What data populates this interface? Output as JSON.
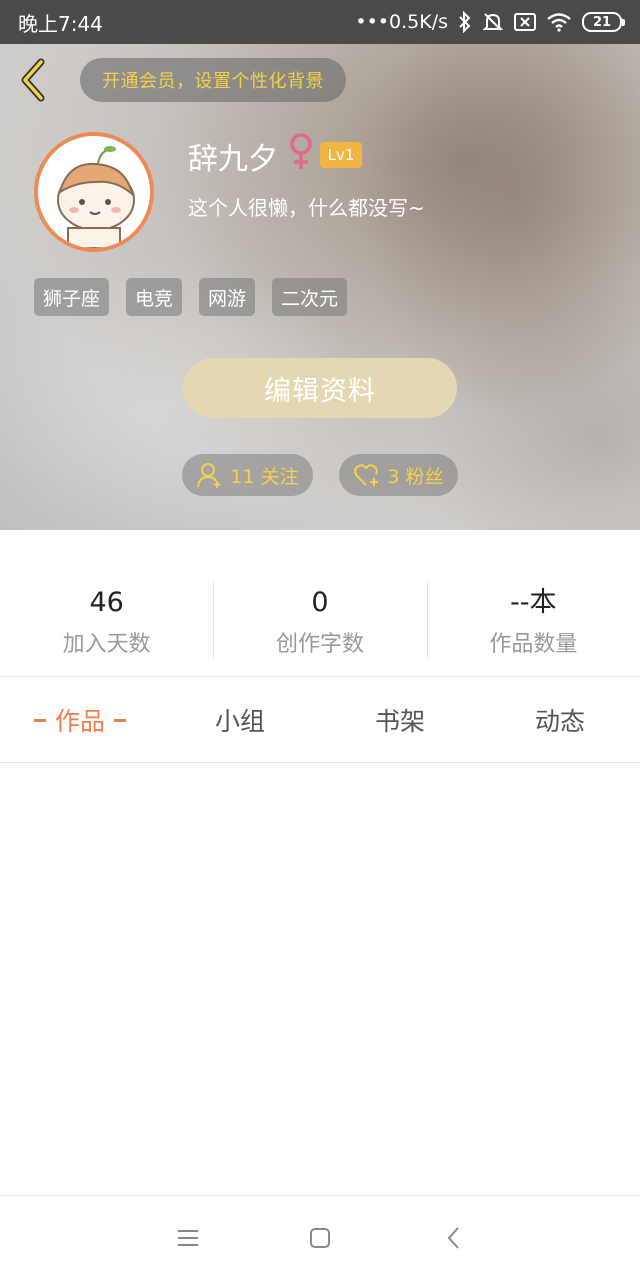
{
  "status_bar": {
    "time": "晚上7:44",
    "network_speed": "•••0.5K/s",
    "battery_level": "21",
    "icons": [
      "bluetooth-icon",
      "mute-bell-icon",
      "sim-icon",
      "wifi-icon",
      "battery-icon"
    ]
  },
  "header": {
    "vip_banner": "开通会员，设置个性化背景",
    "username": "辞九夕",
    "gender_symbol": "♀",
    "level": "Lv1",
    "bio": "这个人很懒，什么都没写~",
    "tags": [
      "狮子座",
      "电竞",
      "网游",
      "二次元"
    ],
    "edit_button": "编辑资料",
    "following": "11 关注",
    "fans": "3 粉丝"
  },
  "stats": [
    {
      "value": "46",
      "label": "加入天数"
    },
    {
      "value": "0",
      "label": "创作字数"
    },
    {
      "value": "--本",
      "label": "作品数量"
    }
  ],
  "tabs": [
    {
      "label": "作品",
      "active": true
    },
    {
      "label": "小组",
      "active": false
    },
    {
      "label": "书架",
      "active": false
    },
    {
      "label": "动态",
      "active": false
    }
  ],
  "colors": {
    "accent": "#ef7e4a",
    "gold": "#f2d246",
    "level_badge": "#f0b542",
    "edit_button": "#e6d7b3",
    "gender": "#e06a8a"
  },
  "navbar": {
    "icons": [
      "menu-icon",
      "home-square-icon",
      "back-chevron-icon"
    ]
  }
}
